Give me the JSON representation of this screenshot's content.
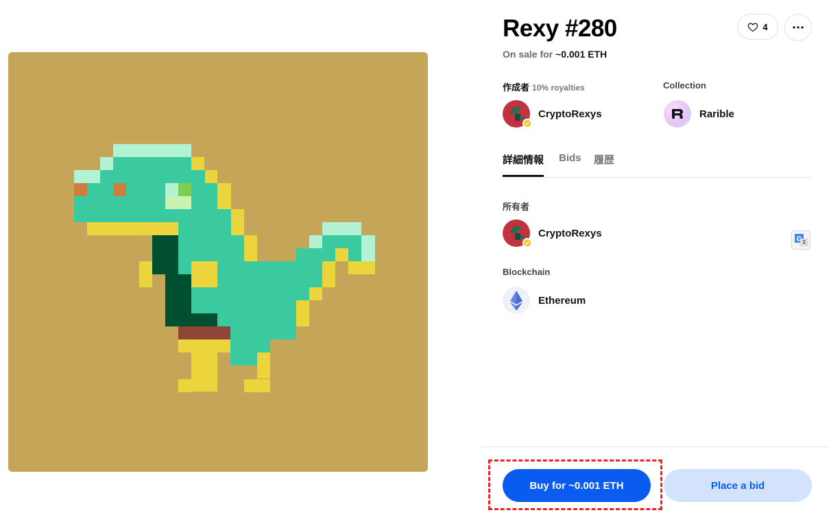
{
  "nft": {
    "title": "Rexy #280",
    "sale_prefix": "On sale for",
    "sale_price": "~0.001 ETH",
    "likes": "4"
  },
  "creator": {
    "label": "作成者",
    "royalties": "10% royalties",
    "name": "CryptoRexys"
  },
  "collection": {
    "label": "Collection",
    "name": "Rarible"
  },
  "tabs": [
    {
      "label": "詳細情報",
      "active": true
    },
    {
      "label": "Bids",
      "active": false
    },
    {
      "label": "履歴",
      "active": false
    }
  ],
  "owner": {
    "label": "所有者",
    "name": "CryptoRexys"
  },
  "blockchain": {
    "label": "Blockchain",
    "name": "Ethereum"
  },
  "actions": {
    "buy_label": "Buy for ~0.001 ETH",
    "bid_label": "Place a bid"
  },
  "colors": {
    "art_background": "#C5A558",
    "primary_blue": "#0A5CF0",
    "secondary_blue": "#D3E3FB",
    "highlight_red": "#E52424",
    "verified_badge": "#F5C518"
  },
  "icons": {
    "like": "heart-icon",
    "more": "ellipsis-icon",
    "translate": "google-translate-icon",
    "chain": "ethereum-icon",
    "verified": "verified-check-icon"
  }
}
